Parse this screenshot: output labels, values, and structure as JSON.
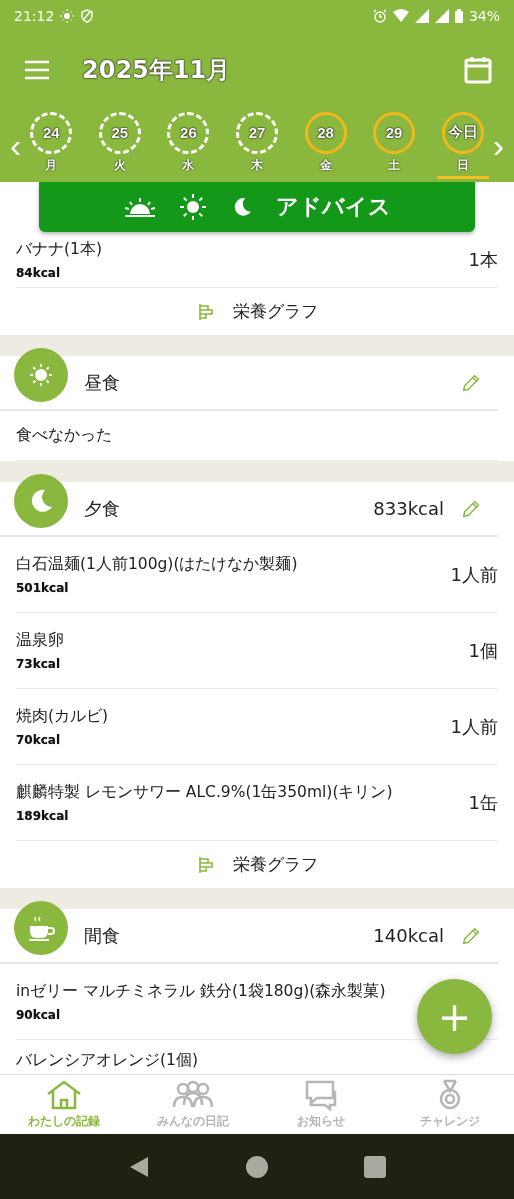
{
  "status_bar": {
    "time": "21:12",
    "battery": "34%"
  },
  "header": {
    "title": "2025年11月",
    "prev": "‹",
    "next": "›"
  },
  "days": [
    {
      "date": "24",
      "weekday": "月",
      "logged": true,
      "selected": false
    },
    {
      "date": "25",
      "weekday": "火",
      "logged": true,
      "selected": false
    },
    {
      "date": "26",
      "weekday": "水",
      "logged": true,
      "selected": false
    },
    {
      "date": "27",
      "weekday": "木",
      "logged": true,
      "selected": false
    },
    {
      "date": "28",
      "weekday": "金",
      "logged": false,
      "selected": false
    },
    {
      "date": "29",
      "weekday": "土",
      "logged": false,
      "selected": false
    },
    {
      "date": "今日",
      "weekday": "日",
      "logged": false,
      "selected": true
    }
  ],
  "advice": {
    "label": "アドバイス"
  },
  "sections": [
    {
      "kind": "tail",
      "items": [
        {
          "name": "バナナ(1本)",
          "kcal": "84kcal",
          "qty": "1本"
        }
      ],
      "graph": "栄養グラフ"
    },
    {
      "kind": "meal",
      "title": "昼食",
      "note": "食べなかった"
    },
    {
      "kind": "meal",
      "title": "夕食",
      "total": "833kcal",
      "items": [
        {
          "name": "白石温麺(1人前100g)(はたけなか製麺)",
          "kcal": "501kcal",
          "qty": "1人前"
        },
        {
          "name": "温泉卵",
          "kcal": "73kcal",
          "qty": "1個"
        },
        {
          "name": "焼肉(カルビ)",
          "kcal": "70kcal",
          "qty": "1人前"
        },
        {
          "name": "麒麟特製 レモンサワー ALC.9%(1缶350ml)(キリン)",
          "kcal": "189kcal",
          "qty": "1缶"
        }
      ],
      "graph": "栄養グラフ"
    },
    {
      "kind": "meal",
      "title": "間食",
      "total": "140kcal",
      "items": [
        {
          "name": "inゼリー マルチミネラル 鉄分(1袋180g)(森永製菓)",
          "kcal": "90kcal"
        },
        {
          "name": "バレンシアオレンジ(1個)"
        }
      ]
    }
  ],
  "fab": "+",
  "tabs": [
    {
      "label": "わたしの記録",
      "selected": true
    },
    {
      "label": "みんなの日記",
      "selected": false
    },
    {
      "label": "お知らせ",
      "selected": false
    },
    {
      "label": "チャレンジ",
      "selected": false
    }
  ]
}
